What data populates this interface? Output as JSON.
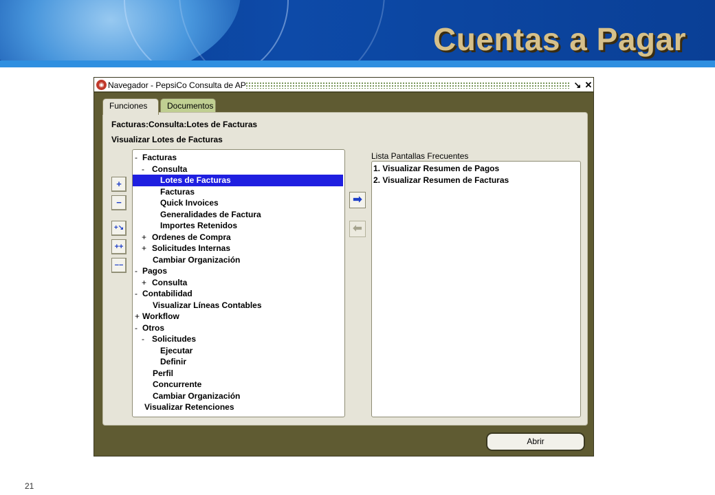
{
  "slide": {
    "title": "Cuentas a Pagar",
    "page_number": "21"
  },
  "window": {
    "title": "Navegador - PepsiCo Consulta de AP",
    "minimize_glyph": "↘",
    "close_glyph": "✕"
  },
  "tabs": [
    {
      "label": "Funciones",
      "active": true
    },
    {
      "label": "Documentos",
      "active": false
    }
  ],
  "panel": {
    "breadcrumb": "Facturas:Consulta:Lotes de Facturas",
    "subtitle": "Visualizar Lotes de Facturas"
  },
  "toolbar": {
    "expand_glyph": "+",
    "collapse_glyph": "−",
    "expand_branch_glyph": "+↘",
    "expand_all_glyph": "++",
    "collapse_all_glyph": "−−",
    "add_glyph": "➡",
    "remove_glyph": "⬅"
  },
  "tree": {
    "selected_index": 2,
    "nodes": [
      {
        "mark": "-",
        "label": "Facturas",
        "level": 0
      },
      {
        "mark": "-",
        "label": "Consulta",
        "level": 1
      },
      {
        "mark": "",
        "label": "Lotes de Facturas",
        "level": 2
      },
      {
        "mark": "",
        "label": "Facturas",
        "level": 2
      },
      {
        "mark": "",
        "label": "Quick Invoices",
        "level": 2
      },
      {
        "mark": "",
        "label": "Generalidades de Factura",
        "level": 2
      },
      {
        "mark": "",
        "label": "Importes Retenidos",
        "level": 2
      },
      {
        "mark": "+",
        "label": "Ordenes de Compra",
        "level": 1
      },
      {
        "mark": "+",
        "label": "Solicitudes Internas",
        "level": 1
      },
      {
        "mark": "",
        "label": "Cambiar Organización",
        "level": 1
      },
      {
        "mark": "-",
        "label": "Pagos",
        "level": 0
      },
      {
        "mark": "+",
        "label": "Consulta",
        "level": 1
      },
      {
        "mark": "-",
        "label": "Contabilidad",
        "level": 0
      },
      {
        "mark": "",
        "label": "Visualizar Líneas Contables",
        "level": 1
      },
      {
        "mark": "+",
        "label": "Workflow",
        "level": 0
      },
      {
        "mark": "-",
        "label": "Otros",
        "level": 0
      },
      {
        "mark": "-",
        "label": "Solicitudes",
        "level": 1
      },
      {
        "mark": "",
        "label": "Ejecutar",
        "level": 2
      },
      {
        "mark": "",
        "label": "Definir",
        "level": 2
      },
      {
        "mark": "",
        "label": "Perfil",
        "level": 1
      },
      {
        "mark": "",
        "label": "Concurrente",
        "level": 1
      },
      {
        "mark": "",
        "label": "Cambiar Organización",
        "level": 1
      },
      {
        "mark": "",
        "label": "Visualizar Retenciones",
        "level": 0
      }
    ]
  },
  "frequent": {
    "label": "Lista Pantallas Frecuentes",
    "items": [
      "1. Visualizar Resumen de Pagos",
      "2. Visualizar Resumen de Facturas"
    ]
  },
  "open_button": {
    "label": "Abrir"
  }
}
